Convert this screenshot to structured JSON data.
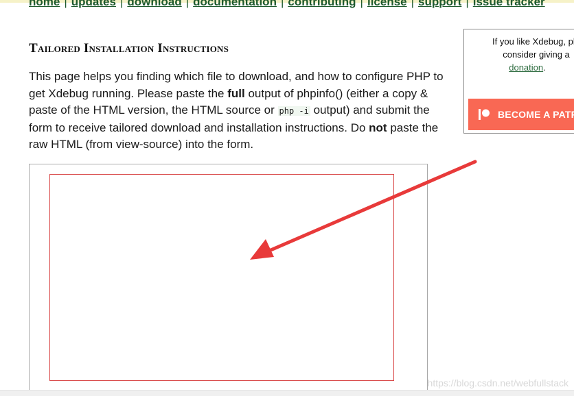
{
  "nav": {
    "items": [
      {
        "label": "home"
      },
      {
        "label": "updates"
      },
      {
        "label": "download"
      },
      {
        "label": "documentation"
      },
      {
        "label": "contributing"
      },
      {
        "label": "license"
      },
      {
        "label": "support"
      },
      {
        "label": "issue tracker"
      }
    ],
    "separator": "|"
  },
  "main": {
    "heading": "Tailored Installation Instructions",
    "intro": {
      "part1": "This page helps you finding which file to download, and how to configure PHP to get Xdebug running. Please paste the ",
      "bold1": "full",
      "part2": " output of phpinfo() (either a copy & paste of the HTML version, the HTML source or ",
      "code1": "php -i",
      "part3": " output) and submit the form to receive tailored download and installation instructions. Do ",
      "bold2": "not",
      "part4": " paste the raw HTML (from view-source) into the form."
    },
    "textarea": {
      "value": "",
      "placeholder": ""
    }
  },
  "sidebar": {
    "line1": "If you like Xdebug, ple",
    "line2": "consider giving a",
    "donation_link": "donation",
    "donation_suffix": ".",
    "patreon_button": {
      "label": "BECOME A PATR",
      "icon": "patreon-icon"
    }
  },
  "annotation": {
    "arrow_color": "#e83a3a",
    "icon": "red-arrow-annotation"
  },
  "watermark": {
    "text": "https://blog.csdn.net/webfullstack"
  },
  "colors": {
    "link_green": "#1e5a2d",
    "patreon_orange": "#f96854",
    "textarea_border": "#d94848"
  }
}
